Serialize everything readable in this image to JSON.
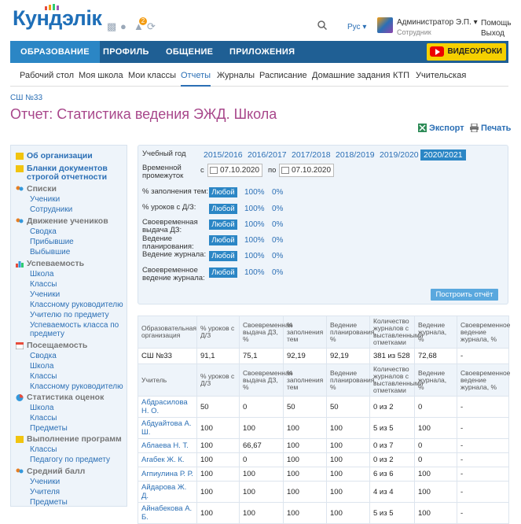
{
  "header": {
    "logo": "Кундэлік",
    "notif_count": "2",
    "lang": "Рус",
    "user_name": "Администратор Э.П.",
    "user_role": "Сотрудник",
    "help": "Помощь",
    "logout": "Выход"
  },
  "mainnav": [
    "ОБРАЗОВАНИЕ",
    "ПРОФИЛЬ",
    "ОБЩЕНИЕ",
    "ПРИЛОЖЕНИЯ"
  ],
  "video_label": "ВИДЕОУРОКИ",
  "subnav": [
    "Рабочий стол",
    "Моя школа",
    "Мои классы",
    "Отчеты",
    "Журналы",
    "Расписание",
    "Домашние задания",
    "КТП",
    "Учительская"
  ],
  "breadcrumb": "СШ №33",
  "page_title": "Отчет: Статистика ведения ЭЖД. Школа",
  "export_label": "Экспорт",
  "print_label": "Печать",
  "sidebar": {
    "org": "Об организации",
    "forms": "Бланки документов строгой отчетности",
    "lists": "Списки",
    "lists_items": [
      "Ученики",
      "Сотрудники"
    ],
    "movement": "Движение учеников",
    "movement_items": [
      "Сводка",
      "Прибывшие",
      "Выбывшие"
    ],
    "progress": "Успеваемость",
    "progress_items": [
      "Школа",
      "Классы",
      "Ученики",
      "Классному руководителю",
      "Учителю по предмету",
      "Успеваемость класса по предмету"
    ],
    "attendance": "Посещаемость",
    "attendance_items": [
      "Сводка",
      "Школа",
      "Классы",
      "Классному руководителю"
    ],
    "grades": "Статистика оценок",
    "grades_items": [
      "Школа",
      "Классы",
      "Предметы"
    ],
    "programs": "Выполнение программ",
    "programs_items": [
      "Классы",
      "Педагогу по предмету"
    ],
    "avg": "Средний балл",
    "avg_items": [
      "Ученики",
      "Учителя",
      "Предметы"
    ]
  },
  "filter": {
    "year_label": "Учебный год",
    "years": [
      "2015/2016",
      "2016/2017",
      "2017/2018",
      "2018/2019",
      "2019/2020",
      "2020/2021"
    ],
    "period_label": "Временной промежуток",
    "from_label": "с",
    "to_label": "по",
    "date_from": "07.10.2020",
    "date_to": "07.10.2020",
    "rows": [
      {
        "label": "% заполнения тем:",
        "chip": "Любой",
        "v1": "100%",
        "v2": "0%"
      },
      {
        "label": "% уроков с Д/З:",
        "chip": "Любой",
        "v1": "100%",
        "v2": "0%"
      },
      {
        "label": "Своевременная выдача ДЗ:",
        "chip": "Любой",
        "v1": "100%",
        "v2": "0%"
      },
      {
        "label": "Ведение планирования:",
        "chip": "Любой",
        "v1": "100%",
        "v2": "0%"
      },
      {
        "label": "Ведение журнала:",
        "chip": "Любой",
        "v1": "100%",
        "v2": "0%"
      },
      {
        "label": "Своевременное ведение журнала:",
        "chip": "Любой",
        "v1": "100%",
        "v2": "0%"
      }
    ],
    "build_button": "Построить отчёт"
  },
  "school_table": {
    "headers": [
      "Образовательная организация",
      "% уроков с Д/З",
      "Своевременная выдача ДЗ, %",
      "% заполнения тем",
      "Ведение планирования, %",
      "Количество журналов с выставленными отметками",
      "Ведение журнала, %",
      "Своевременное ведение журнала, %"
    ],
    "row": [
      "СШ №33",
      "91,1",
      "75,1",
      "92,19",
      "92,19",
      "381 из 528",
      "72,68",
      "-"
    ]
  },
  "teacher_table": {
    "headers": [
      "Учитель",
      "% уроков с Д/З",
      "Своевременная выдача ДЗ, %",
      "% заполнения тем",
      "Ведение планирования, %",
      "Количество журналов с выставленными отметками",
      "Ведение журнала, %",
      "Своевременное ведение журнала, %"
    ],
    "rows": [
      [
        "Абдрасилова Н. О.",
        "50",
        "0",
        "50",
        "50",
        "0 из 2",
        "0",
        "-"
      ],
      [
        "Абдуайтова А. Ш.",
        "100",
        "100",
        "100",
        "100",
        "5 из 5",
        "100",
        "-"
      ],
      [
        "Аблаева Н. Т.",
        "100",
        "66,67",
        "100",
        "100",
        "0 из 7",
        "0",
        "-"
      ],
      [
        "Агабек Ж. К.",
        "100",
        "0",
        "100",
        "100",
        "0 из 2",
        "0",
        "-"
      ],
      [
        "Агпиулина Р. Р.",
        "100",
        "100",
        "100",
        "100",
        "6 из 6",
        "100",
        "-"
      ],
      [
        "Айдарова Ж. Д.",
        "100",
        "100",
        "100",
        "100",
        "4 из 4",
        "100",
        "-"
      ],
      [
        "Айнабекова А. Б.",
        "100",
        "100",
        "100",
        "100",
        "5 из 5",
        "100",
        "-"
      ]
    ]
  }
}
